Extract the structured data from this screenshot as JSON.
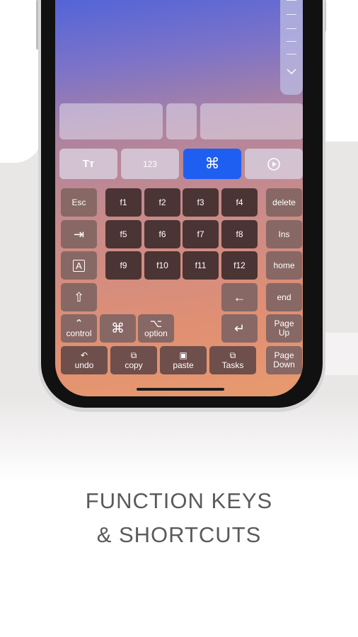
{
  "mode_tabs": [
    {
      "label": "Tт",
      "icon": "text-format-icon",
      "active": false
    },
    {
      "label": "123",
      "icon": "numbers-icon",
      "active": false
    },
    {
      "label": "⌘",
      "icon": "command-icon",
      "active": true
    },
    {
      "label": "",
      "icon": "play-circle-icon",
      "active": false
    }
  ],
  "keys": {
    "esc": "Esc",
    "f1": "f1",
    "f2": "f2",
    "f3": "f3",
    "f4": "f4",
    "f5": "f5",
    "f6": "f6",
    "f7": "f7",
    "f8": "f8",
    "f9": "f9",
    "f10": "f10",
    "f11": "f11",
    "f12": "f12",
    "delete": "delete",
    "ins": "Ins",
    "home": "home",
    "end": "end",
    "page_up": "Page\nUp",
    "page_down": "Page\nDown",
    "control": "control",
    "option": "option",
    "undo": "undo",
    "copy": "copy",
    "paste": "paste",
    "tasks": "Tasks",
    "tab_glyph": "⇥",
    "caps_glyph": "A",
    "shift_glyph": "⇧",
    "cmd_glyph": "⌘",
    "ctrl_glyph": "⌃",
    "option_glyph": "⌥",
    "left_arrow_glyph": "←",
    "return_glyph": "↵"
  },
  "caption": {
    "line1": "FUNCTION KEYS",
    "line2": "& SHORTCUTS"
  },
  "colors": {
    "accent": "#1e5ff2",
    "key": "#6e4f4b",
    "caption": "#5a5a5a"
  }
}
